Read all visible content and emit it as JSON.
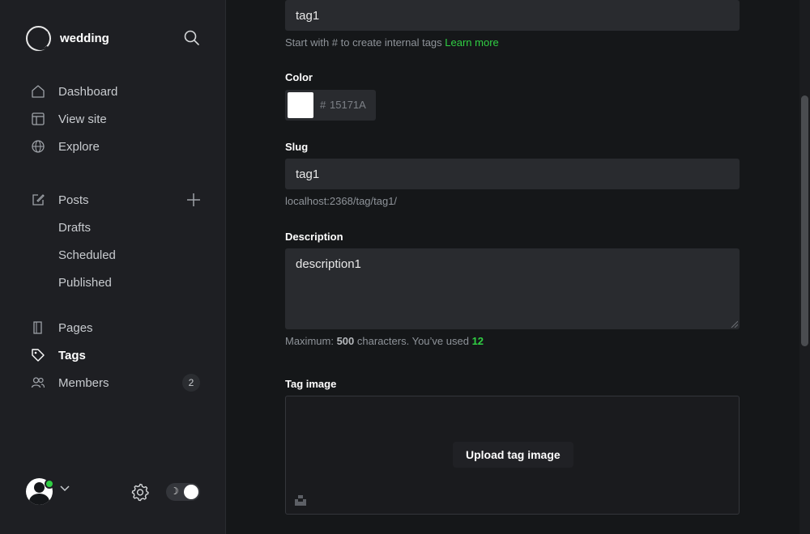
{
  "sidebar": {
    "brand": {
      "name": "wedding"
    },
    "nav": [
      {
        "label": "Dashboard",
        "icon": "home-icon"
      },
      {
        "label": "View site",
        "icon": "layout-icon"
      },
      {
        "label": "Explore",
        "icon": "globe-icon"
      }
    ],
    "posts": {
      "label": "Posts",
      "sub": [
        "Drafts",
        "Scheduled",
        "Published"
      ]
    },
    "nav2": [
      {
        "label": "Pages",
        "icon": "pages-icon"
      },
      {
        "label": "Tags",
        "icon": "tag-icon",
        "active": true
      },
      {
        "label": "Members",
        "icon": "members-icon",
        "count": "2"
      }
    ],
    "footer": {
      "theme_icon": "☽"
    }
  },
  "form": {
    "name_value": "tag1",
    "name_hint": "Start with # to create internal tags",
    "learn_more": "Learn more",
    "color_label": "Color",
    "color_hash": "#",
    "color_value": "15171A",
    "slug_label": "Slug",
    "slug_value": "tag1",
    "slug_url": "localhost:2368/tag/tag1/",
    "description_label": "Description",
    "description_value": "description1",
    "desc_hint_prefix": "Maximum:",
    "desc_hint_max": "500",
    "desc_hint_mid": "characters. You’ve used",
    "desc_hint_used": "12",
    "tag_image_label": "Tag image",
    "upload_label": "Upload tag image"
  },
  "colors": {
    "accent": "#30cf43",
    "sidebar_bg": "#1e1f23",
    "main_bg": "#151719"
  }
}
